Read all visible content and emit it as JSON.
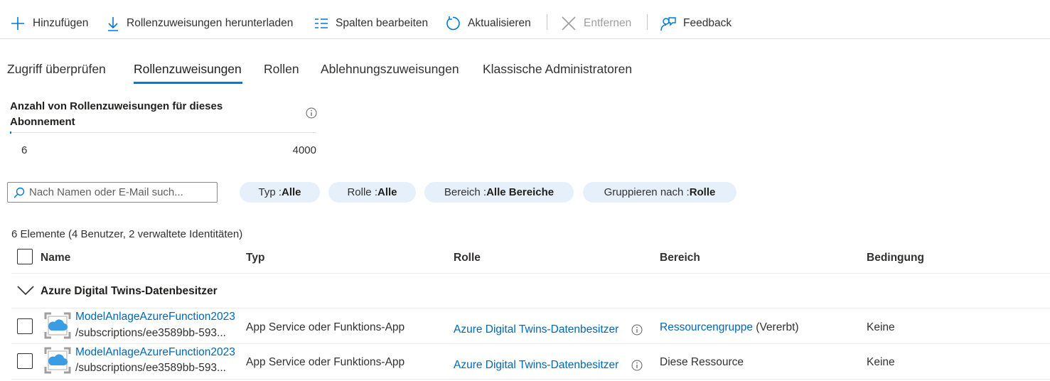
{
  "toolbar": {
    "add": "Hinzufügen",
    "download": "Rollenzuweisungen herunterladen",
    "edit_columns": "Spalten bearbeiten",
    "refresh": "Aktualisieren",
    "remove": "Entfernen",
    "feedback": "Feedback"
  },
  "tabs": [
    {
      "label": "Zugriff überprüfen"
    },
    {
      "label": "Rollenzuweisungen",
      "active": true
    },
    {
      "label": "Rollen"
    },
    {
      "label": "Ablehnungszuweisungen"
    },
    {
      "label": "Klassische Administratoren"
    }
  ],
  "count": {
    "title": "Anzahl von Rollenzuweisungen für dieses Abonnement",
    "current": "6",
    "max": "4000",
    "fraction": 0.0015
  },
  "search": {
    "placeholder": "Nach Namen oder E-Mail such..."
  },
  "filters": [
    {
      "label": "Typ : ",
      "value": "Alle"
    },
    {
      "label": "Rolle : ",
      "value": "Alle"
    },
    {
      "label": "Bereich : ",
      "value": "Alle Bereiche"
    },
    {
      "label": "Gruppieren nach : ",
      "value": "Rolle"
    }
  ],
  "summary": "6 Elemente (4 Benutzer, 2 verwaltete Identitäten)",
  "table": {
    "headers": {
      "name": "Name",
      "type": "Typ",
      "role": "Rolle",
      "scope": "Bereich",
      "condition": "Bedingung"
    },
    "group": {
      "label": "Azure Digital Twins-Datenbesitzer"
    },
    "rows": [
      {
        "name": "ModelAnlageAzureFunction2023",
        "path": "/subscriptions/ee3589bb-593...",
        "type": "App Service oder Funktions-App",
        "role": "Azure Digital Twins-Datenbesitzer",
        "scope": "Ressourcengruppe",
        "scope_suffix": " (Vererbt)",
        "condition": "Keine"
      },
      {
        "name": "ModelAnlageAzureFunction2023",
        "path": "/subscriptions/ee3589bb-593...",
        "type": "App Service oder Funktions-App",
        "role": "Azure Digital Twins-Datenbesitzer",
        "scope": "Diese Ressource",
        "scope_suffix": "",
        "condition": "Keine"
      }
    ]
  },
  "icons": {
    "add": "plus-icon",
    "download": "download-icon",
    "edit_columns": "columns-icon",
    "refresh": "refresh-icon",
    "remove": "close-icon",
    "feedback": "feedback-icon",
    "info": "info-icon",
    "search": "search-icon",
    "expand": "chevron-down-icon",
    "app": "app-service-icon"
  },
  "colors": {
    "accent": "#0078d4",
    "link": "#0067b8",
    "pill_bg": "#e6f0fa",
    "disabled": "#a19f9d"
  }
}
